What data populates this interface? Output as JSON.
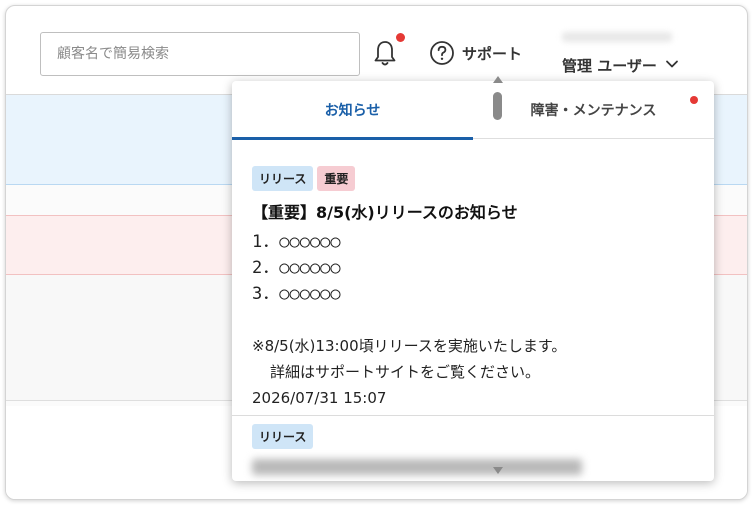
{
  "header": {
    "search_placeholder": "顧客名で簡易検索",
    "support_label": "サポート",
    "user_label": "管理 ユーザー"
  },
  "icons": {
    "bell": "bell-icon",
    "help": "question-circle-icon",
    "chevron": "chevron-down-icon"
  },
  "colors": {
    "accent": "#1a5fa8",
    "notification_dot": "#e53935",
    "badge_release": "#cfe5f7",
    "badge_important": "#f6ccd2"
  },
  "popup": {
    "tabs": [
      {
        "label": "お知らせ",
        "active": true
      },
      {
        "label": "障害・メンテナンス",
        "active": false,
        "has_dot": true
      }
    ],
    "items": [
      {
        "badges": [
          "リリース",
          "重要"
        ],
        "title": "【重要】8/5(水)リリースのお知らせ",
        "lines": [
          "1．○○○○○○",
          "2．○○○○○○",
          "3．○○○○○○"
        ],
        "note_1": "※8/5(水)13:00頃リリースを実施いたします。",
        "note_2": "詳細はサポートサイトをご覧ください。",
        "date": "2026/07/31 15:07"
      },
      {
        "badges": [
          "リリース"
        ]
      }
    ]
  }
}
